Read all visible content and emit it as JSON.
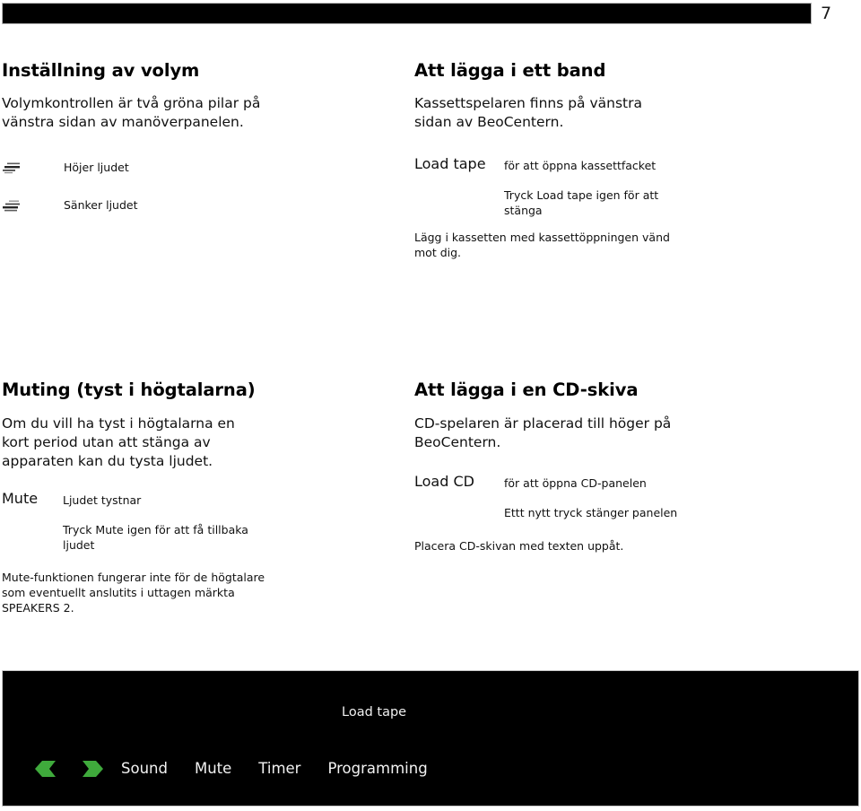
{
  "page": {
    "number": "7",
    "language": "sv"
  },
  "colors": {
    "bar": "#000000",
    "panel_background": "#000000",
    "panel_border": "#c9c9c9",
    "arrow_green": "#3faa3c",
    "panel_text": "#f2f2f2",
    "body_text": "#111111"
  },
  "sections": {
    "volume": {
      "title": "Inställning av volym",
      "intro": "Volymkontrollen är två gröna pilar på vänstra sidan av manöverpanelen.",
      "rows": [
        {
          "icon": "volume-up-icon",
          "label": "Höjer ljudet"
        },
        {
          "icon": "volume-down-icon",
          "label": "Sänker ljudet"
        }
      ]
    },
    "tape": {
      "title": "Att lägga i ett band",
      "intro": "Kassettspelaren finns på vänstra sidan av BeoCentern.",
      "command": "Load tape",
      "command_desc": "för att öppna kassettfacket",
      "command_desc2": "Tryck Load tape igen för att stänga",
      "note": "Lägg i kassetten med kassettöppningen vänd mot dig."
    },
    "muting": {
      "title": "Muting (tyst i högtalarna)",
      "intro": "Om du vill ha tyst i högtalarna en kort period utan att stänga av apparaten kan du tysta ljudet.",
      "command": "Mute",
      "command_desc": "Ljudet tystnar",
      "command_desc2": "Tryck Mute igen för att få tillbaka ljudet",
      "note": "Mute-funktionen fungerar inte för de högtalare som eventuellt anslutits i uttagen märkta SPEAKERS 2."
    },
    "cd": {
      "title": "Att lägga i en CD-skiva",
      "intro": "CD-spelaren är placerad till höger på BeoCentern.",
      "command": "Load CD",
      "command_desc": "för att öppna CD-panelen",
      "command_desc2": "Ettt nytt tryck stänger panelen",
      "note": "Placera CD-skivan med texten uppåt."
    }
  },
  "bottom_panel": {
    "caption": "Load tape",
    "arrows": [
      {
        "name": "volume-down-arrow-icon",
        "direction": "left"
      },
      {
        "name": "volume-up-arrow-icon",
        "direction": "right"
      }
    ],
    "buttons": [
      "Sound",
      "Mute",
      "Timer",
      "Programming"
    ]
  }
}
